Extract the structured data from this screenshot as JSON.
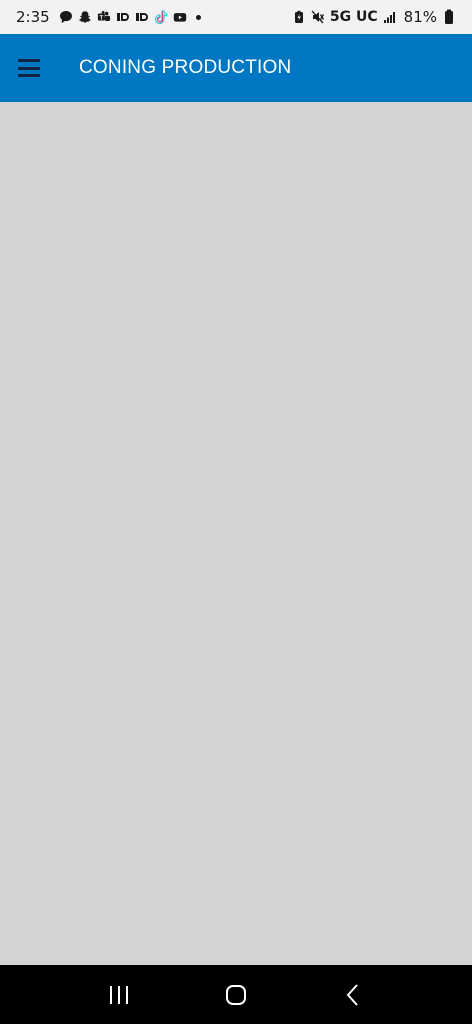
{
  "status_bar": {
    "time": "2:35",
    "network": "5G UC",
    "battery": "81%",
    "icons": [
      "chat-icon",
      "snapchat-icon",
      "teams-icon",
      "id-icon",
      "id-icon",
      "tiktok-icon",
      "youtube-icon",
      "dot-icon",
      "battery-saver-icon",
      "mute-icon",
      "signal-icon",
      "battery-icon"
    ]
  },
  "app_bar": {
    "title": "CONING PRODUCTION",
    "background": "#0077c2"
  },
  "content": {
    "background": "#d3d3d3"
  },
  "nav_bar": {
    "buttons": [
      "recents-icon",
      "home-icon",
      "back-icon"
    ]
  }
}
